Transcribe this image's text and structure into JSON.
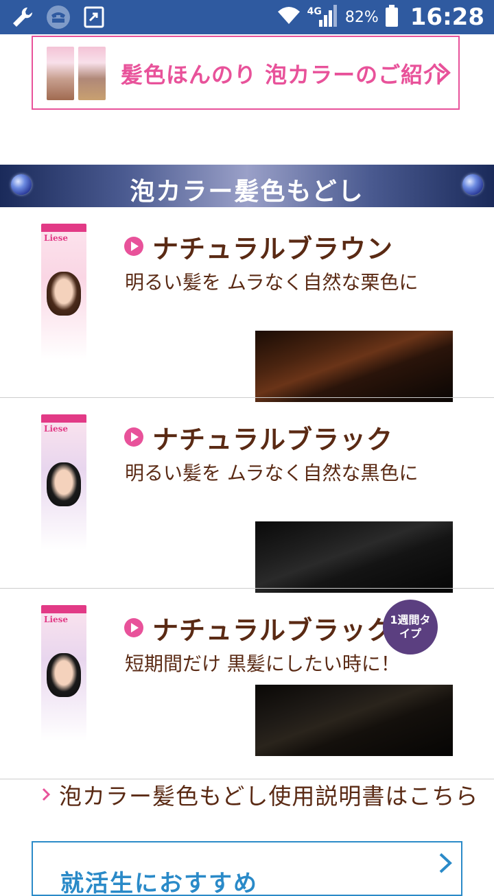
{
  "status_bar": {
    "network": "4G",
    "battery": "82%",
    "time": "16:28",
    "icons": [
      "wrench-icon",
      "voicemail-icon",
      "cast-icon",
      "wifi-icon",
      "signal-icon",
      "battery-icon"
    ]
  },
  "top_banner": {
    "text": "髪色ほんのり 泡カラーのご紹介"
  },
  "section": {
    "title": "泡カラー髪色もどし"
  },
  "products": [
    {
      "name": "ナチュラルブラウン",
      "description": "明るい髪を ムラなく自然な栗色に",
      "box_label": "Liese",
      "swatch": "brown"
    },
    {
      "name": "ナチュラルブラック",
      "description": "明るい髪を ムラなく自然な黒色に",
      "box_label": "Liese",
      "swatch": "black"
    },
    {
      "name": "ナチュラルブラック",
      "description": "短期間だけ 黒髪にしたい時に！",
      "box_label": "Liese",
      "badge": "1週間タイプ",
      "swatch": "blackbrown"
    }
  ],
  "manual_link": "泡カラー髪色もどし使用説明書はこちら",
  "bottom_banner": "就活生におすすめ",
  "colors": {
    "status_bar": "#2f5aa0",
    "accent_pink": "#e8529a",
    "title_brown": "#5a2a14",
    "badge_purple": "#5b3f80",
    "link_blue": "#2a8ac8"
  }
}
